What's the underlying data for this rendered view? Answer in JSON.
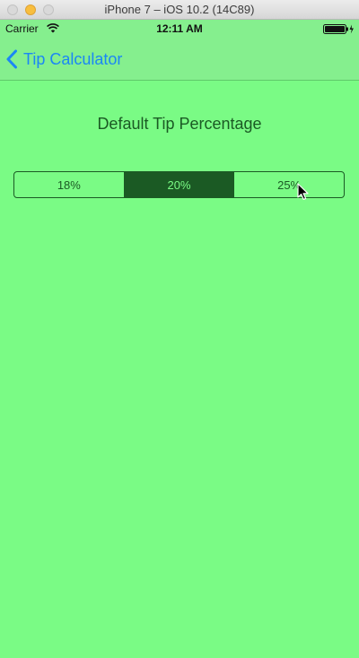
{
  "window": {
    "title": "iPhone 7 – iOS 10.2 (14C89)"
  },
  "status_bar": {
    "carrier": "Carrier",
    "time": "12:11 AM",
    "wifi_icon": "wifi-icon",
    "battery_icon": "battery-charging-icon"
  },
  "nav": {
    "back_label": "Tip Calculator",
    "back_icon": "chevron-left-icon"
  },
  "main": {
    "heading": "Default Tip Percentage",
    "segments": [
      "18%",
      "20%",
      "25%"
    ],
    "selected_index": 1
  },
  "colors": {
    "background": "#7afb85",
    "bar": "#85ef8e",
    "tint": "#1b5a24",
    "link": "#1b86f5"
  }
}
